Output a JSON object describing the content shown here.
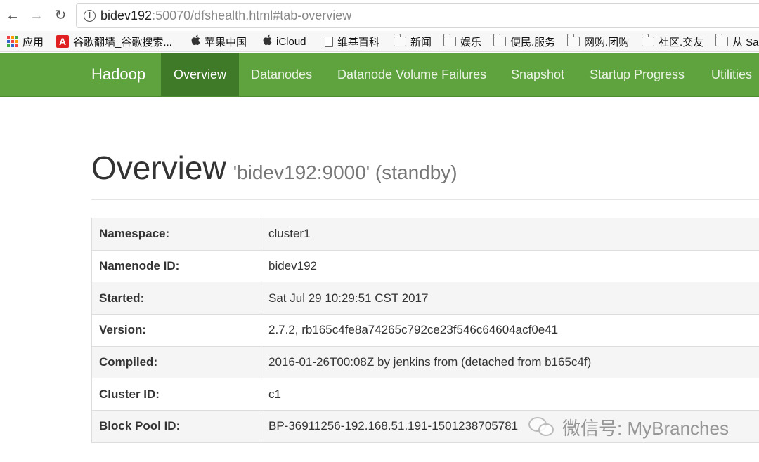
{
  "browser": {
    "url_host": "bidev192",
    "url_rest": ":50070/dfshealth.html#tab-overview",
    "bookmarks": [
      {
        "label": "应用",
        "icon": "apps-grid-icon"
      },
      {
        "label": "谷歌翻墙_谷歌搜索...",
        "icon": "red-a-icon"
      },
      {
        "label": "苹果中国",
        "icon": "apple-icon"
      },
      {
        "label": "iCloud",
        "icon": "apple-icon"
      },
      {
        "label": "维基百科",
        "icon": "page-icon"
      },
      {
        "label": "新闻",
        "icon": "folder-icon"
      },
      {
        "label": "娱乐",
        "icon": "folder-icon"
      },
      {
        "label": "便民.服务",
        "icon": "folder-icon"
      },
      {
        "label": "网购.团购",
        "icon": "folder-icon"
      },
      {
        "label": "社区.交友",
        "icon": "folder-icon"
      },
      {
        "label": "从 Sa",
        "icon": "folder-icon"
      }
    ]
  },
  "navbar": {
    "brand": "Hadoop",
    "links": [
      "Overview",
      "Datanodes",
      "Datanode Volume Failures",
      "Snapshot",
      "Startup Progress",
      "Utilities"
    ],
    "active": "Overview",
    "color": "#5fa33e",
    "active_color": "#3f7a28"
  },
  "page": {
    "title": "Overview",
    "subtitle": "'bidev192:9000' (standby)"
  },
  "overview_table": [
    {
      "key": "Namespace:",
      "value": "cluster1"
    },
    {
      "key": "Namenode ID:",
      "value": "bidev192"
    },
    {
      "key": "Started:",
      "value": "Sat Jul 29 10:29:51 CST 2017"
    },
    {
      "key": "Version:",
      "value": "2.7.2, rb165c4fe8a74265c792ce23f546c64604acf0e41"
    },
    {
      "key": "Compiled:",
      "value": "2016-01-26T00:08Z by jenkins from (detached from b165c4f)"
    },
    {
      "key": "Cluster ID:",
      "value": "c1"
    },
    {
      "key": "Block Pool ID:",
      "value": "BP-36911256-192.168.51.191-1501238705781"
    }
  ],
  "watermark": {
    "text": "微信号: MyBranches"
  }
}
